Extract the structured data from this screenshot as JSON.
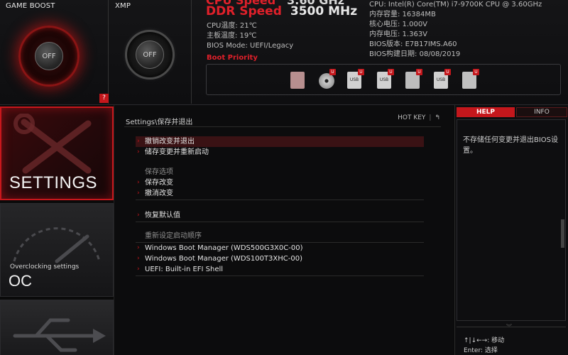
{
  "header": {
    "game_boost": {
      "title": "GAME BOOST",
      "state": "OFF",
      "help": "?"
    },
    "xmp": {
      "title": "XMP",
      "state": "OFF"
    },
    "cpu_speed": {
      "label": "CPU Speed",
      "value": "3.60 GHz"
    },
    "ddr_speed": {
      "label": "DDR Speed",
      "value": "3500 MHz"
    },
    "left_info": [
      "CPU温度: 21℃",
      "主板温度: 19℃",
      "BIOS Mode: UEFI/Legacy"
    ],
    "right_info": [
      "CPU: Intel(R) Core(TM) i7-9700K CPU @ 3.60GHz",
      "内存容量: 16384MB",
      "核心电压: 1.000V",
      "内存电压: 1.363V",
      "BIOS版本: E7B17IMS.A60",
      "BIOS构建日期: 08/08/2019"
    ],
    "boot_priority_label": "Boot Priority",
    "boot_devices": [
      {
        "icon": "hard-drive-icon",
        "badge": ""
      },
      {
        "icon": "optical-disc-icon",
        "badge": "U"
      },
      {
        "icon": "usb-drive-icon",
        "label": "USB",
        "badge": "U"
      },
      {
        "icon": "usb-disc-icon",
        "label": "USB",
        "badge": "U"
      },
      {
        "icon": "usb-device-icon",
        "label": "",
        "badge": "U"
      },
      {
        "icon": "usb-stick-icon",
        "label": "USB",
        "badge": "U"
      },
      {
        "icon": "network-card-icon",
        "label": "",
        "badge": "U"
      }
    ]
  },
  "sidebar": {
    "settings": {
      "title": "SETTINGS"
    },
    "oc": {
      "subtitle": "Overclocking settings",
      "title": "OC"
    }
  },
  "main": {
    "breadcrumb": "Settings\\保存并退出",
    "hotkey": {
      "label": "HOT KEY",
      "sep": "|",
      "back": "↰"
    },
    "items_top": [
      {
        "label": "撤销改变并退出",
        "selected": true
      },
      {
        "label": "储存变更并重新启动",
        "selected": false
      }
    ],
    "save_group": {
      "label": "保存选项",
      "items": [
        "保存改变",
        "撤消改变"
      ]
    },
    "restore": "恢复默认值",
    "boot_override_group": {
      "label": "重新设定启动顺序",
      "items": [
        "Windows Boot Manager (WDS500G3X0C-00)",
        "Windows Boot Manager (WDS100T3XHC-00)",
        "UEFI: Built-in EFI Shell"
      ]
    }
  },
  "help_panel": {
    "tabs": [
      "HELP",
      "INFO"
    ],
    "text": "不存储任何变更并退出BIOS设置。",
    "keys": [
      "↑|↓←→: 移动",
      "Enter: 选择"
    ]
  },
  "colors": {
    "accent_red": "#c4171c",
    "text_red": "#e0202a",
    "background": "#0b0b0c"
  }
}
